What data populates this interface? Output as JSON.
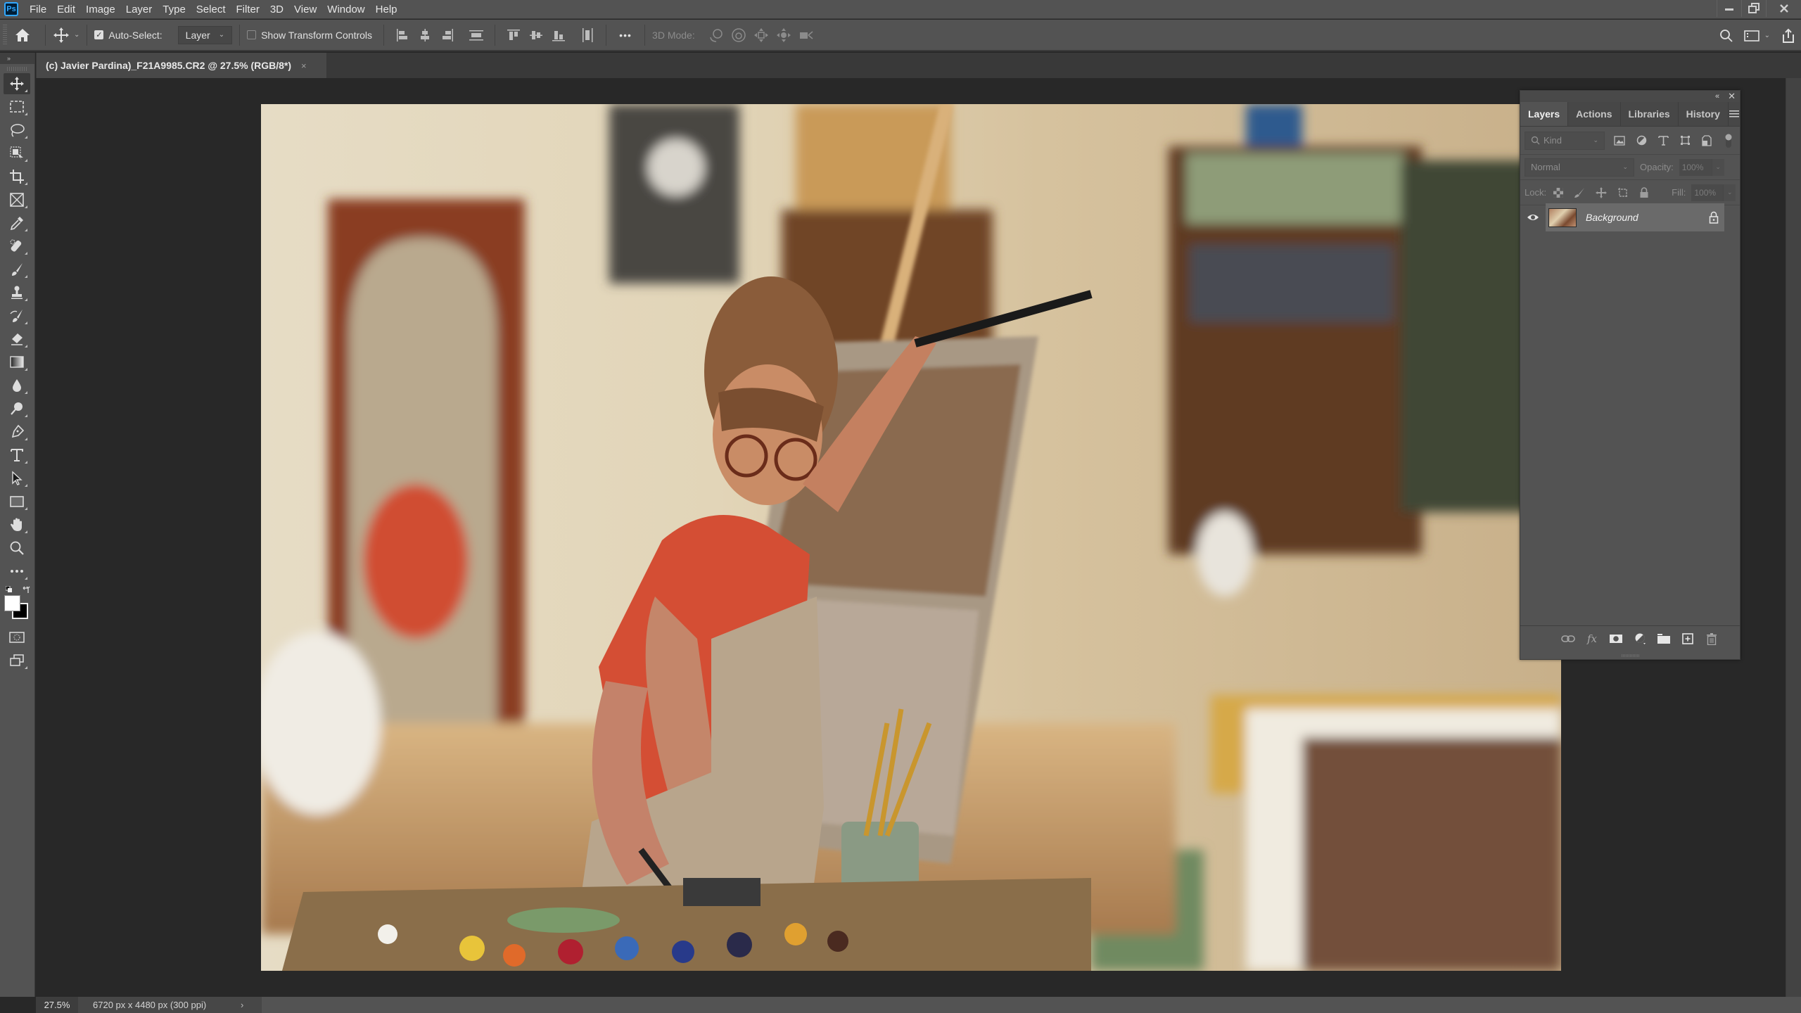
{
  "app": {
    "logo": "Ps",
    "menu": [
      "File",
      "Edit",
      "Image",
      "Layer",
      "Type",
      "Select",
      "Filter",
      "3D",
      "View",
      "Window",
      "Help"
    ],
    "window_controls": {
      "minimize": "—",
      "restore": "⧉",
      "close": "✕"
    }
  },
  "options_bar": {
    "tool_icon": "move-icon",
    "auto_select_checked": true,
    "auto_select_label": "Auto-Select:",
    "auto_select_target": "Layer",
    "show_transform_checked": false,
    "show_transform_label": "Show Transform Controls",
    "more_label": "•••",
    "mode3d_label": "3D Mode:"
  },
  "toolbar": {
    "expand_label": "»",
    "tools": [
      {
        "name": "move-tool",
        "active": true
      },
      {
        "name": "rectangular-marquee-tool"
      },
      {
        "name": "lasso-tool"
      },
      {
        "name": "object-selection-tool"
      },
      {
        "name": "crop-tool"
      },
      {
        "name": "frame-tool"
      },
      {
        "name": "eyedropper-tool"
      },
      {
        "name": "spot-healing-brush-tool"
      },
      {
        "name": "brush-tool"
      },
      {
        "name": "clone-stamp-tool"
      },
      {
        "name": "history-brush-tool"
      },
      {
        "name": "eraser-tool"
      },
      {
        "name": "gradient-tool"
      },
      {
        "name": "blur-tool"
      },
      {
        "name": "dodge-tool"
      },
      {
        "name": "pen-tool"
      },
      {
        "name": "type-tool"
      },
      {
        "name": "path-selection-tool"
      },
      {
        "name": "rectangle-tool"
      },
      {
        "name": "hand-tool"
      },
      {
        "name": "zoom-tool"
      },
      {
        "name": "edit-toolbar"
      }
    ],
    "foreground_color": "#ffffff",
    "background_color": "#000000"
  },
  "document": {
    "tab_title": "(c) Javier Pardina)_F21A9985.CR2 @ 27.5% (RGB/8*)",
    "tab_close": "×"
  },
  "layers_panel": {
    "tabs": [
      "Layers",
      "Actions",
      "Libraries",
      "History"
    ],
    "active_tab": "Layers",
    "filter_placeholder": "Kind",
    "blend_mode": "Normal",
    "opacity_label": "Opacity:",
    "opacity_value": "100%",
    "lock_label": "Lock:",
    "fill_label": "Fill:",
    "fill_value": "100%",
    "layers": [
      {
        "name": "Background",
        "visible": true,
        "locked": true
      }
    ]
  },
  "status_bar": {
    "zoom": "27.5%",
    "doc_info": "6720 px x 4480 px (300 ppi)",
    "arrow": "›"
  }
}
